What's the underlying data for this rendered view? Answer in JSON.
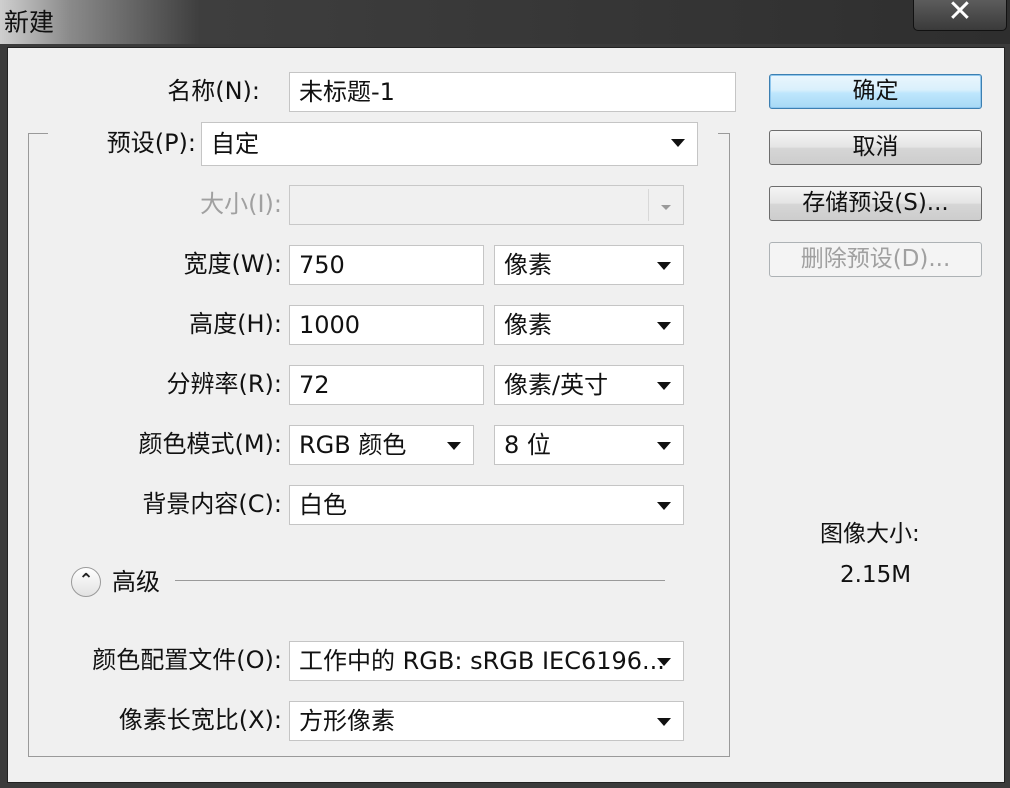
{
  "window": {
    "title": "新建",
    "close_label": "✕"
  },
  "form": {
    "name": {
      "label": "名称(N):",
      "value": "未标题-1"
    },
    "preset": {
      "label": "预设(P):",
      "value": "自定"
    },
    "size": {
      "label": "大小(I):",
      "value": ""
    },
    "width": {
      "label": "宽度(W):",
      "value": "750",
      "unit": "像素"
    },
    "height": {
      "label": "高度(H):",
      "value": "1000",
      "unit": "像素"
    },
    "resolution": {
      "label": "分辨率(R):",
      "value": "72",
      "unit": "像素/英寸"
    },
    "color_mode": {
      "label": "颜色模式(M):",
      "value": "RGB 颜色",
      "bits": "8 位"
    },
    "background": {
      "label": "背景内容(C):",
      "value": "白色"
    },
    "advanced": {
      "label": "高级"
    },
    "color_profile": {
      "label": "颜色配置文件(O):",
      "value": "工作中的 RGB: sRGB IEC6196..."
    },
    "pixel_aspect": {
      "label": "像素长宽比(X):",
      "value": "方形像素"
    }
  },
  "buttons": {
    "ok": "确定",
    "cancel": "取消",
    "save_preset": "存储预设(S)...",
    "delete_preset": "删除预设(D)..."
  },
  "image_size": {
    "label": "图像大小:",
    "value": "2.15M"
  },
  "icons": {
    "close": "close-icon",
    "dropdown": "chevron-down-icon",
    "collapse": "double-chevron-up-icon"
  }
}
